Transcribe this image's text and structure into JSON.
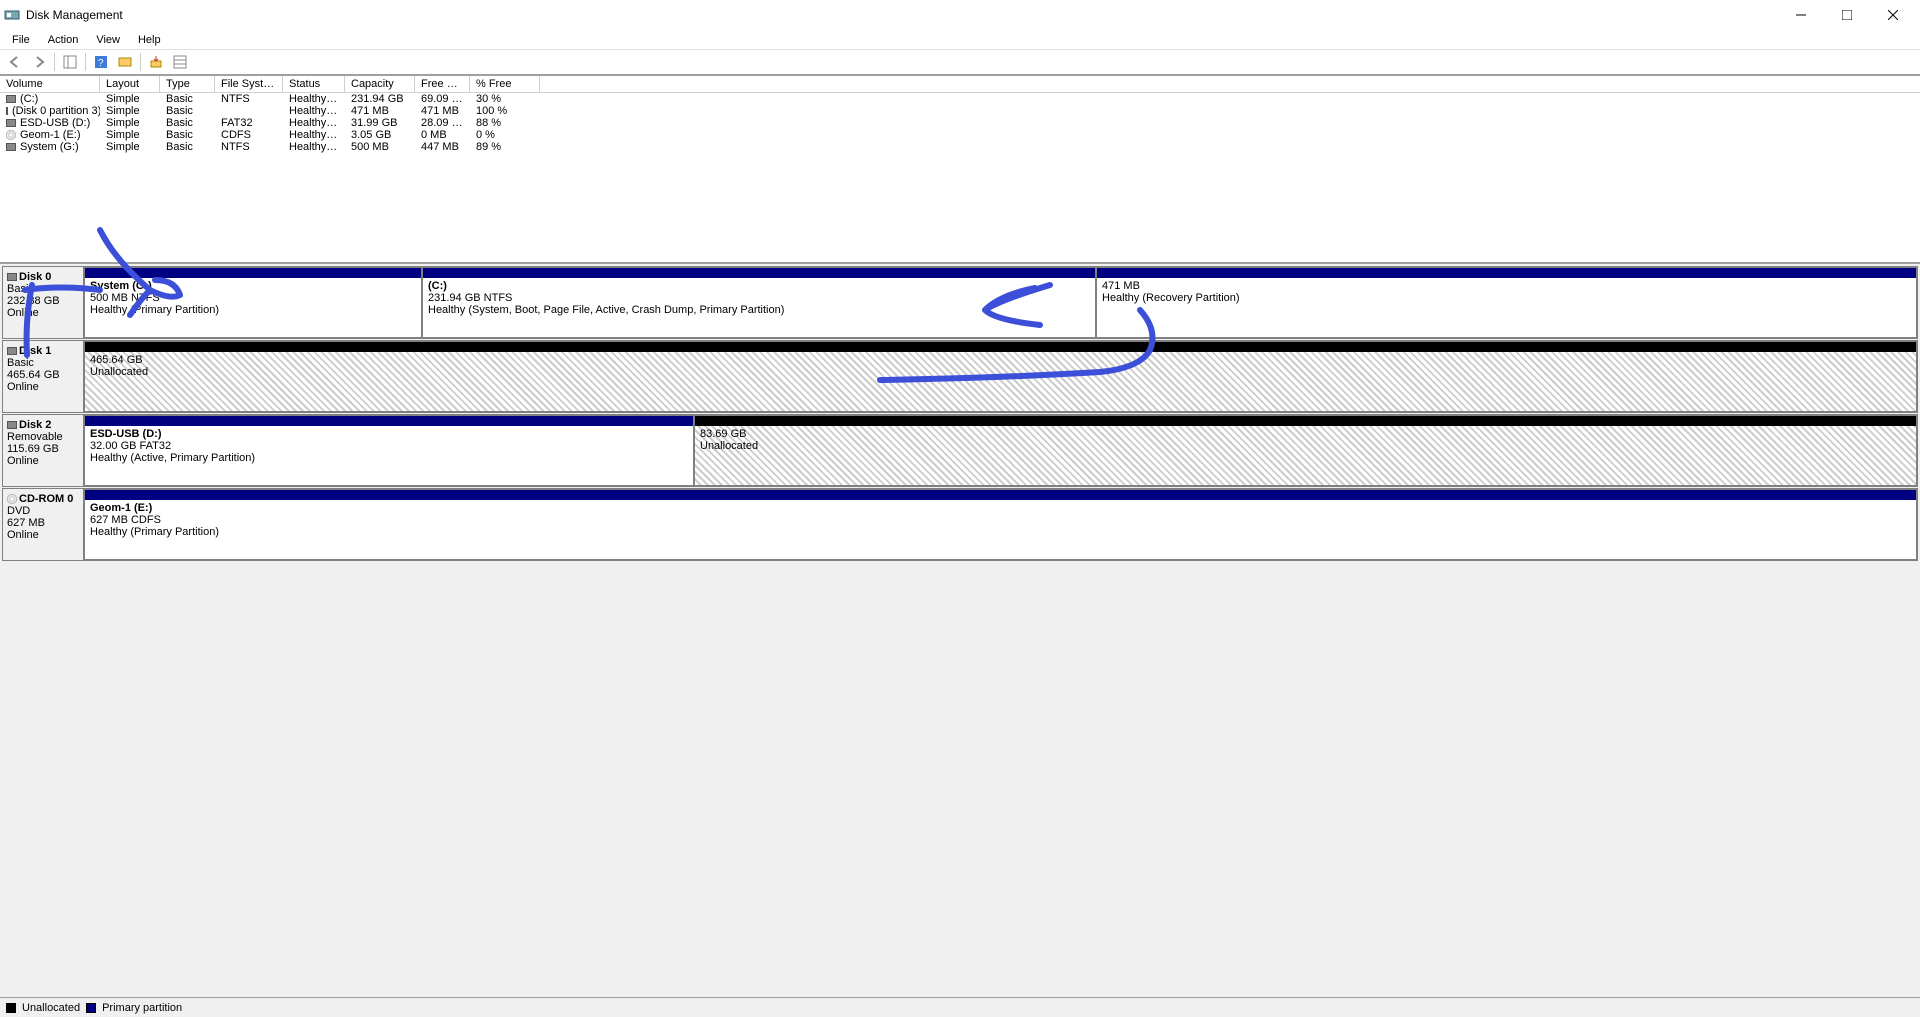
{
  "titlebar": {
    "title": "Disk Management"
  },
  "menubar": {
    "file": "File",
    "action": "Action",
    "view": "View",
    "help": "Help"
  },
  "columns": {
    "volume": "Volume",
    "layout": "Layout",
    "type": "Type",
    "fs": "File System",
    "status": "Status",
    "capacity": "Capacity",
    "free": "Free Spa...",
    "pct": "% Free"
  },
  "rows": [
    {
      "vol": "(C:)",
      "layout": "Simple",
      "type": "Basic",
      "fs": "NTFS",
      "status": "Healthy (S...",
      "cap": "231.94 GB",
      "free": "69.09 GB",
      "pct": "30 %",
      "icon": "disk"
    },
    {
      "vol": "(Disk 0 partition 3)",
      "layout": "Simple",
      "type": "Basic",
      "fs": "",
      "status": "Healthy (R...",
      "cap": "471 MB",
      "free": "471 MB",
      "pct": "100 %",
      "icon": "disk"
    },
    {
      "vol": "ESD-USB (D:)",
      "layout": "Simple",
      "type": "Basic",
      "fs": "FAT32",
      "status": "Healthy (A...",
      "cap": "31.99 GB",
      "free": "28.09 GB",
      "pct": "88 %",
      "icon": "disk"
    },
    {
      "vol": "Geom-1 (E:)",
      "layout": "Simple",
      "type": "Basic",
      "fs": "CDFS",
      "status": "Healthy (P...",
      "cap": "3.05 GB",
      "free": "0 MB",
      "pct": "0 %",
      "icon": "cd"
    },
    {
      "vol": "System (G:)",
      "layout": "Simple",
      "type": "Basic",
      "fs": "NTFS",
      "status": "Healthy (P...",
      "cap": "500 MB",
      "free": "447 MB",
      "pct": "89 %",
      "icon": "disk"
    }
  ],
  "disks": {
    "d0": {
      "name": "Disk 0",
      "type": "Basic",
      "size": "232.88 GB",
      "status": "Online",
      "p0": {
        "name": "System  (G:)",
        "sub": "500 MB NTFS",
        "stat": "Healthy (Primary Partition)"
      },
      "p1": {
        "name": "(C:)",
        "sub": "231.94 GB NTFS",
        "stat": "Healthy (System, Boot, Page File, Active, Crash Dump, Primary Partition)"
      },
      "p2": {
        "name": "",
        "sub": "471 MB",
        "stat": "Healthy (Recovery Partition)"
      }
    },
    "d1": {
      "name": "Disk 1",
      "type": "Basic",
      "size": "465.64 GB",
      "status": "Online",
      "p0": {
        "name": "",
        "sub": "465.64 GB",
        "stat": "Unallocated"
      }
    },
    "d2": {
      "name": "Disk 2",
      "type": "Removable",
      "size": "115.69 GB",
      "status": "Online",
      "p0": {
        "name": "ESD-USB  (D:)",
        "sub": "32.00 GB FAT32",
        "stat": "Healthy (Active, Primary Partition)"
      },
      "p1": {
        "name": "",
        "sub": "83.69 GB",
        "stat": "Unallocated"
      }
    },
    "cd0": {
      "name": "CD-ROM 0",
      "type": "DVD",
      "size": "627 MB",
      "status": "Online",
      "p0": {
        "name": "Geom-1  (E:)",
        "sub": "627 MB CDFS",
        "stat": "Healthy (Primary Partition)"
      }
    }
  },
  "legend": {
    "unalloc": "Unallocated",
    "primary": "Primary partition"
  }
}
